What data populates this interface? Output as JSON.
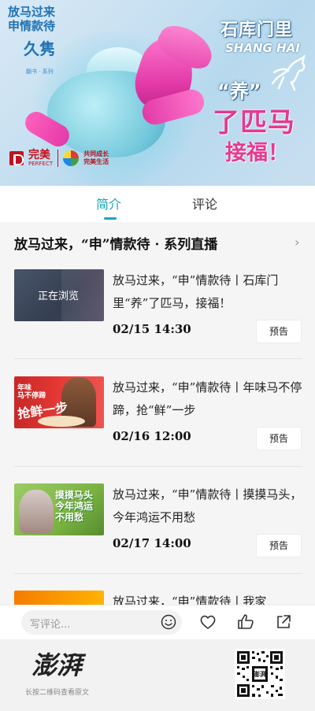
{
  "banner": {
    "title_lines": [
      "放马过来",
      "申情款待"
    ],
    "subtitle": "久隽",
    "small_text": "翻书 · 系列",
    "right_line1": "石库门里",
    "right_en": "SHANG HAI",
    "right_line2": "“养”",
    "right_line3": "了匹马",
    "right_line4": "接福！",
    "logo_cn": "完美",
    "logo_en": "PERFECT",
    "logo_text2_a": "共同成长",
    "logo_text2_b": "完美生活"
  },
  "tabs": {
    "intro": "简介",
    "comment": "评论"
  },
  "series": {
    "title": "放马过来，“申”情款待 · 系列直播",
    "chevron": "›"
  },
  "items": [
    {
      "title": "放马过来，“申”情款待丨石库门里“养”了匹马，接福！",
      "time": "02/15  14:30",
      "button": "预告",
      "thumb_label": "正在浏览"
    },
    {
      "title": "放马过来，“申”情款待丨年味马不停蹄，抢“鲜”一步",
      "time": "02/16  12:00",
      "button": "预告",
      "thumb_line1": "年味",
      "thumb_line2": "马不停蹄",
      "thumb_big": "抢鲜一步"
    },
    {
      "title": "放马过来，“申”情款待丨摸摸马头，今年鸿运不用愁",
      "time": "02/17  14:00",
      "button": "预告",
      "thumb_text": "摸摸马头 今年鸿运 不用愁"
    },
    {
      "title": "放马过来，“申”情款待丨我家",
      "time": "",
      "button": ""
    }
  ],
  "comment_bar": {
    "placeholder": "写评论..."
  },
  "footer": {
    "brand": "澎湃",
    "caption": "长按二维码查看原文"
  },
  "colors": {
    "accent": "#1aa5b8",
    "brand_pink": "#e8388f",
    "brand_red": "#c1121f"
  }
}
